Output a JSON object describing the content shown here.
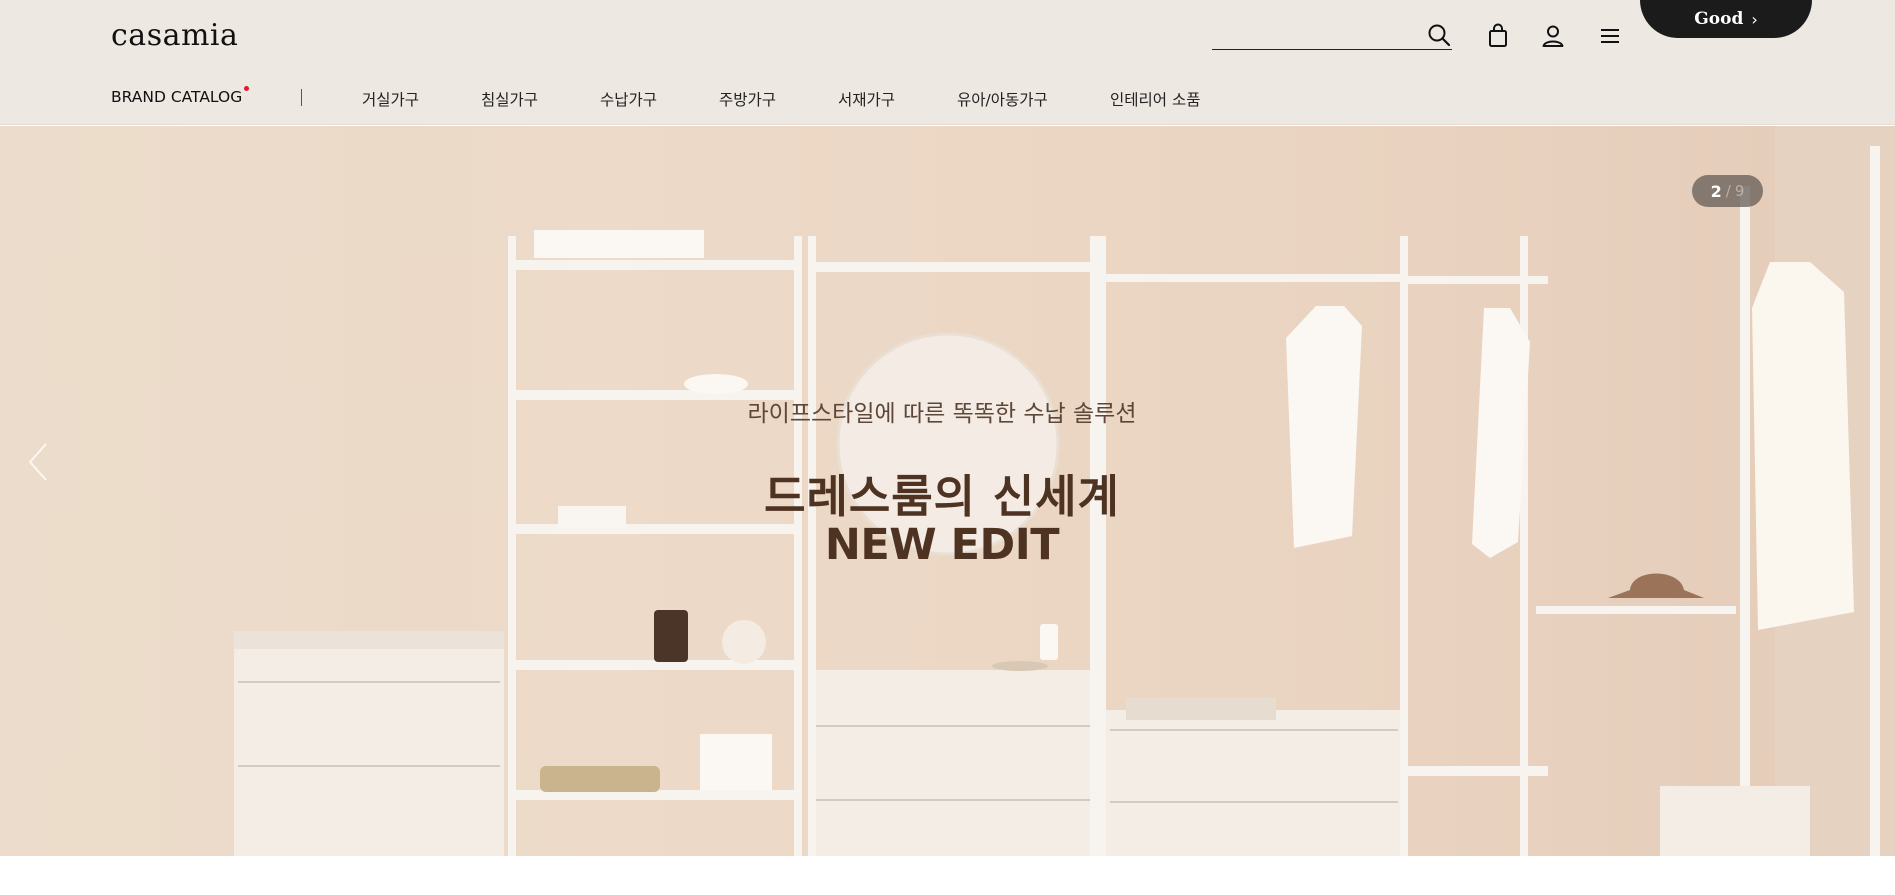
{
  "header": {
    "logo": "casamia",
    "search": {
      "placeholder": "",
      "value": ""
    },
    "icons": [
      "search-icon",
      "bag-icon",
      "user-icon",
      "menu-icon"
    ],
    "good_badge": {
      "label": "Good",
      "chevron": "›"
    }
  },
  "nav": {
    "brand_catalog": "BRAND CATALOG",
    "items": [
      {
        "label": "거실가구"
      },
      {
        "label": "침실가구"
      },
      {
        "label": "수납가구"
      },
      {
        "label": "주방가구"
      },
      {
        "label": "서재가구"
      },
      {
        "label": "유아/아동가구"
      },
      {
        "label": "인테리어 소품"
      }
    ]
  },
  "hero": {
    "subtitle": "라이프스타일에 따른 똑똑한 수납 솔루션",
    "title": "드레스룸의 신세계",
    "title2": "NEW EDIT",
    "counter": {
      "current": "2",
      "separator": "/",
      "total": "9"
    }
  },
  "colors": {
    "header_bg": "#eee8e2",
    "hero_text": "#4e3322",
    "badge_dot": "#e11d2a",
    "good_badge_bg": "#1b1b1b"
  }
}
